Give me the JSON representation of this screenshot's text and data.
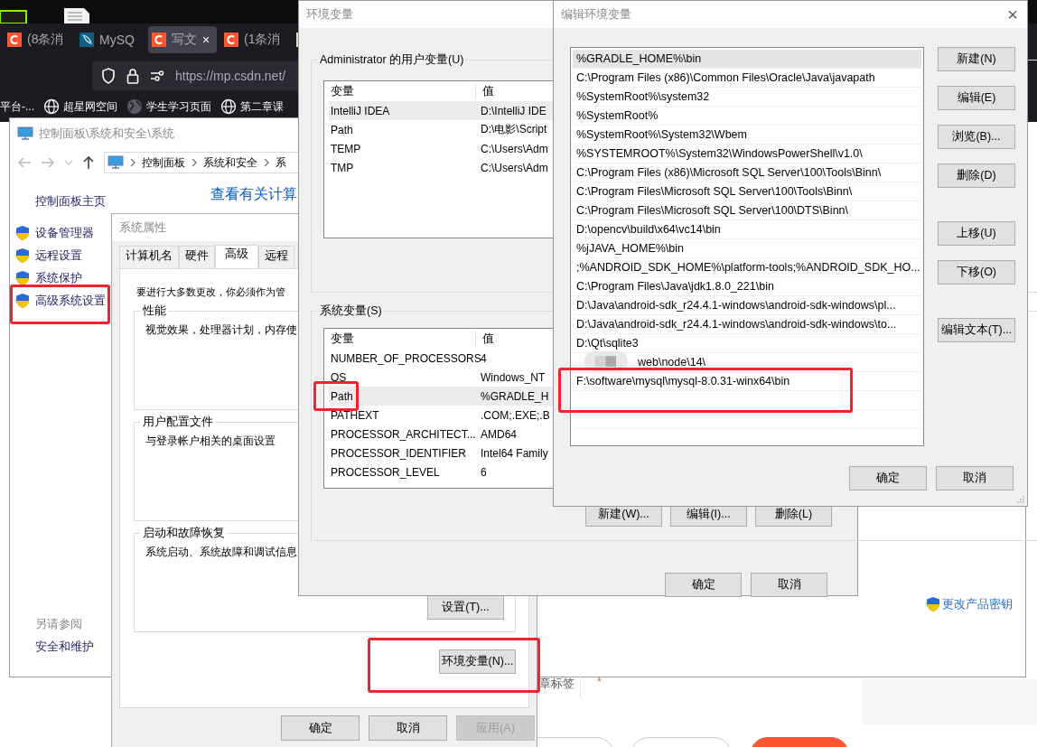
{
  "browser": {
    "tabs": [
      {
        "kind": "csdn",
        "label": "(8条消",
        "selected": false
      },
      {
        "kind": "mysql",
        "label": "MySQ",
        "selected": false
      },
      {
        "kind": "csdn",
        "label": "写文",
        "selected": true,
        "close": "×"
      },
      {
        "kind": "csdn",
        "label": "(1条消",
        "selected": false
      },
      {
        "kind": "image",
        "selected": false
      }
    ],
    "address": "https://mp.csdn.net/",
    "bookmarks": [
      {
        "kind": "plain",
        "label": "平台-..."
      },
      {
        "kind": "globe",
        "label": "超星网空间"
      },
      {
        "kind": "earth",
        "label": "学生学习页面"
      },
      {
        "kind": "globe",
        "label": "第二章课"
      }
    ]
  },
  "control_panel": {
    "title": "控制面板\\系统和安全\\系统",
    "breadcrumb": [
      "控制面板",
      "系统和安全",
      "系"
    ],
    "home_link": "控制面板主页",
    "tasks": [
      "设备管理器",
      "远程设置",
      "系统保护",
      "高级系统设置"
    ],
    "see_also": "另请参阅",
    "see_also_links": [
      "安全和维护"
    ],
    "heading": "查看有关计算",
    "product_key_link": "更改产品密钥"
  },
  "page": {
    "tag_label": "章标签",
    "required_mark": "*"
  },
  "system_properties": {
    "title": "系统属性",
    "tabs": [
      {
        "label": "计算机名",
        "selected": false
      },
      {
        "label": "硬件",
        "selected": false
      },
      {
        "label": "高级",
        "selected": true
      },
      {
        "label": "远程",
        "selected": false
      }
    ],
    "admin_note": "要进行大多数更改，你必须作为管",
    "groups": [
      {
        "title": "性能",
        "text": "视觉效果，处理器计划，内存使"
      },
      {
        "title": "用户配置文件",
        "text": "与登录帐户相关的桌面设置"
      },
      {
        "title": "启动和故障恢复",
        "text": "系统启动、系统故障和调试信息",
        "button": "设置(T)..."
      }
    ],
    "env_button": "环境变量(N)...",
    "buttons": [
      {
        "label": "确定",
        "disabled": false
      },
      {
        "label": "取消",
        "disabled": false
      },
      {
        "label": "应用(A)",
        "disabled": true
      }
    ]
  },
  "environment_variables": {
    "title": "环境变量",
    "user_group": "Administrator 的用户变量(U)",
    "user_table": {
      "columns": [
        "变量",
        "值"
      ],
      "rows": [
        {
          "name": "IntelliJ IDEA",
          "value": "D:\\IntelliJ IDE",
          "selected": true
        },
        {
          "name": "Path",
          "value": "D:\\电影\\Script",
          "selected": false
        },
        {
          "name": "TEMP",
          "value": "C:\\Users\\Adm",
          "selected": false
        },
        {
          "name": "TMP",
          "value": "C:\\Users\\Adm",
          "selected": false
        }
      ]
    },
    "system_group": "系统变量(S)",
    "system_table": {
      "columns": [
        "变量",
        "值"
      ],
      "rows": [
        {
          "name": "NUMBER_OF_PROCESSORS",
          "value": "4",
          "selected": false
        },
        {
          "name": "OS",
          "value": "Windows_NT",
          "selected": false
        },
        {
          "name": "Path",
          "value": "%GRADLE_H",
          "selected": true
        },
        {
          "name": "PATHEXT",
          "value": ".COM;.EXE;.B",
          "selected": false
        },
        {
          "name": "PROCESSOR_ARCHITECT...",
          "value": "AMD64",
          "selected": false
        },
        {
          "name": "PROCESSOR_IDENTIFIER",
          "value": "Intel64 Family",
          "selected": false
        },
        {
          "name": "PROCESSOR_LEVEL",
          "value": "6",
          "selected": false
        }
      ]
    },
    "system_buttons": [
      "新建(W)...",
      "编辑(I)...",
      "删除(L)"
    ],
    "buttons": [
      "确定",
      "取消"
    ]
  },
  "edit_variable": {
    "title": "编辑环境变量",
    "close": "×",
    "entries": [
      {
        "kind": "text",
        "text": "%GRADLE_HOME%\\bin",
        "selected": true
      },
      {
        "kind": "text",
        "text": "C:\\Program Files (x86)\\Common Files\\Oracle\\Java\\javapath",
        "selected": false
      },
      {
        "kind": "text",
        "text": "%SystemRoot%\\system32",
        "selected": false
      },
      {
        "kind": "text",
        "text": "%SystemRoot%",
        "selected": false
      },
      {
        "kind": "text",
        "text": "%SystemRoot%\\System32\\Wbem",
        "selected": false
      },
      {
        "kind": "text",
        "text": "%SYSTEMROOT%\\System32\\WindowsPowerShell\\v1.0\\",
        "selected": false
      },
      {
        "kind": "text",
        "text": "C:\\Program Files (x86)\\Microsoft SQL Server\\100\\Tools\\Binn\\",
        "selected": false
      },
      {
        "kind": "text",
        "text": "C:\\Program Files\\Microsoft SQL Server\\100\\Tools\\Binn\\",
        "selected": false
      },
      {
        "kind": "text",
        "text": "C:\\Program Files\\Microsoft SQL Server\\100\\DTS\\Binn\\",
        "selected": false
      },
      {
        "kind": "text",
        "text": "D:\\opencv\\build\\x64\\vc14\\bin",
        "selected": false
      },
      {
        "kind": "text",
        "text": "%jJAVA_HOME%\\bin",
        "selected": false
      },
      {
        "kind": "text",
        "text": ";%ANDROID_SDK_HOME%\\platform-tools;%ANDROID_SDK_HO...",
        "selected": false
      },
      {
        "kind": "text",
        "text": "C:\\Program Files\\Java\\jdk1.8.0_221\\bin",
        "selected": false
      },
      {
        "kind": "text",
        "text": "D:\\Java\\android-sdk_r24.4.1-windows\\android-sdk-windows\\pl...",
        "selected": false
      },
      {
        "kind": "text",
        "text": "D:\\Java\\android-sdk_r24.4.1-windows\\android-sdk-windows\\to...",
        "selected": false
      },
      {
        "kind": "text",
        "text": "D:\\Qt\\sqlite3",
        "selected": false
      },
      {
        "kind": "redacted",
        "text": "web\\node\\14\\",
        "selected": false
      },
      {
        "kind": "text",
        "text": "F:\\software\\mysql\\mysql-8.0.31-winx64\\bin",
        "selected": false
      }
    ],
    "side_button_groups": [
      [
        "新建(N)",
        "编辑(E)",
        "浏览(B)...",
        "删除(D)"
      ],
      [
        "上移(U)",
        "下移(O)"
      ],
      [
        "编辑文本(T)..."
      ]
    ],
    "buttons": [
      "确定",
      "取消"
    ]
  }
}
